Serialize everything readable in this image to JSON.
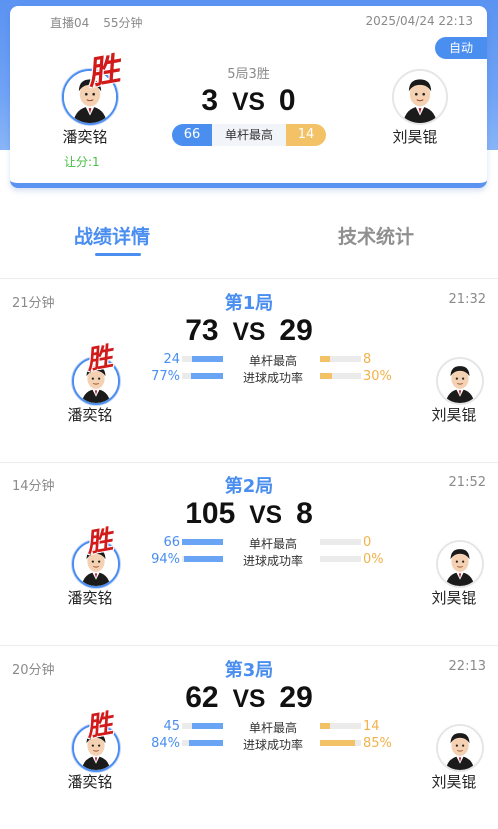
{
  "header": {
    "room": "直播04",
    "duration": "55分钟",
    "datetime": "2025/04/24 22:13",
    "mode_badge": "自动",
    "format": "5局3胜",
    "score_left": "3",
    "vs": "VS",
    "score_right": "0",
    "highest_break_left": "66",
    "highest_break_label": "单杆最高",
    "highest_break_right": "14",
    "win_stamp": "胜",
    "handicap": "让分:1"
  },
  "players": {
    "left": "潘奕铭",
    "right": "刘昊锟"
  },
  "tabs": [
    {
      "label": "战绩详情",
      "active": true
    },
    {
      "label": "技术统计",
      "active": false
    }
  ],
  "frames": [
    {
      "duration": "21分钟",
      "end_time": "21:32",
      "title": "第1局",
      "score_left": "73",
      "score_right": "29",
      "winner": "left",
      "win_stamp": "胜",
      "stats": [
        {
          "label": "单杆最高",
          "left": "24",
          "right": "8",
          "left_ratio": 0.75,
          "right_ratio": 0.25
        },
        {
          "label": "进球成功率",
          "left": "77%",
          "right": "30%",
          "left_ratio": 0.77,
          "right_ratio": 0.3
        }
      ]
    },
    {
      "duration": "14分钟",
      "end_time": "21:52",
      "title": "第2局",
      "score_left": "105",
      "score_right": "8",
      "winner": "left",
      "win_stamp": "胜",
      "stats": [
        {
          "label": "单杆最高",
          "left": "66",
          "right": "0",
          "left_ratio": 1.0,
          "right_ratio": 0.0
        },
        {
          "label": "进球成功率",
          "left": "94%",
          "right": "0%",
          "left_ratio": 0.94,
          "right_ratio": 0.0
        }
      ]
    },
    {
      "duration": "20分钟",
      "end_time": "22:13",
      "title": "第3局",
      "score_left": "62",
      "score_right": "29",
      "winner": "left",
      "win_stamp": "胜",
      "stats": [
        {
          "label": "单杆最高",
          "left": "45",
          "right": "14",
          "left_ratio": 0.76,
          "right_ratio": 0.24
        },
        {
          "label": "进球成功率",
          "left": "84%",
          "right": "85%",
          "left_ratio": 0.84,
          "right_ratio": 0.85
        }
      ]
    }
  ],
  "colors": {
    "accent": "#4a8ef0",
    "right_accent": "#f3c266",
    "win_red": "#d11a1a",
    "handicap_green": "#47c043"
  },
  "icons": {
    "player_avatar": "cartoon-player-avatar-icon"
  }
}
